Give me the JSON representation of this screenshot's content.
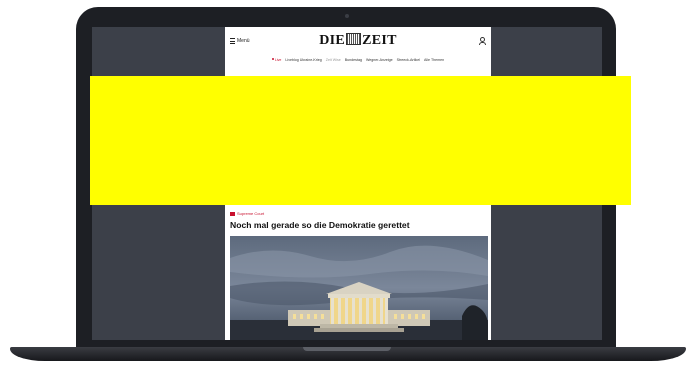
{
  "device": {
    "type": "laptop-mockup",
    "redaction_color": "#ffff00"
  },
  "site": {
    "menu_label": "Menü",
    "logo_left": "DIE",
    "logo_right": "ZEIT",
    "account_icon": "person-icon"
  },
  "nav": {
    "items": [
      {
        "label": "Live",
        "live": true
      },
      {
        "label": "Liveblog Ukraine-Krieg",
        "live": false
      },
      {
        "label": "Zeit Wise",
        "live": false,
        "muted": true
      },
      {
        "label": "Bundestag",
        "live": false
      },
      {
        "label": "Wegner-Anzeige",
        "live": false
      },
      {
        "label": "Streeck-Artikel",
        "live": false
      },
      {
        "label": "Alle Themen",
        "live": false
      }
    ]
  },
  "article": {
    "kicker": "Supreme Court",
    "headline": "Noch mal gerade so die Demokratie gerettet",
    "image_subject": "supreme-court-building-at-dusk"
  },
  "colors": {
    "accent": "#c8102e",
    "screen_bg": "#3c4049",
    "laptop_body": "#1d1f24"
  }
}
